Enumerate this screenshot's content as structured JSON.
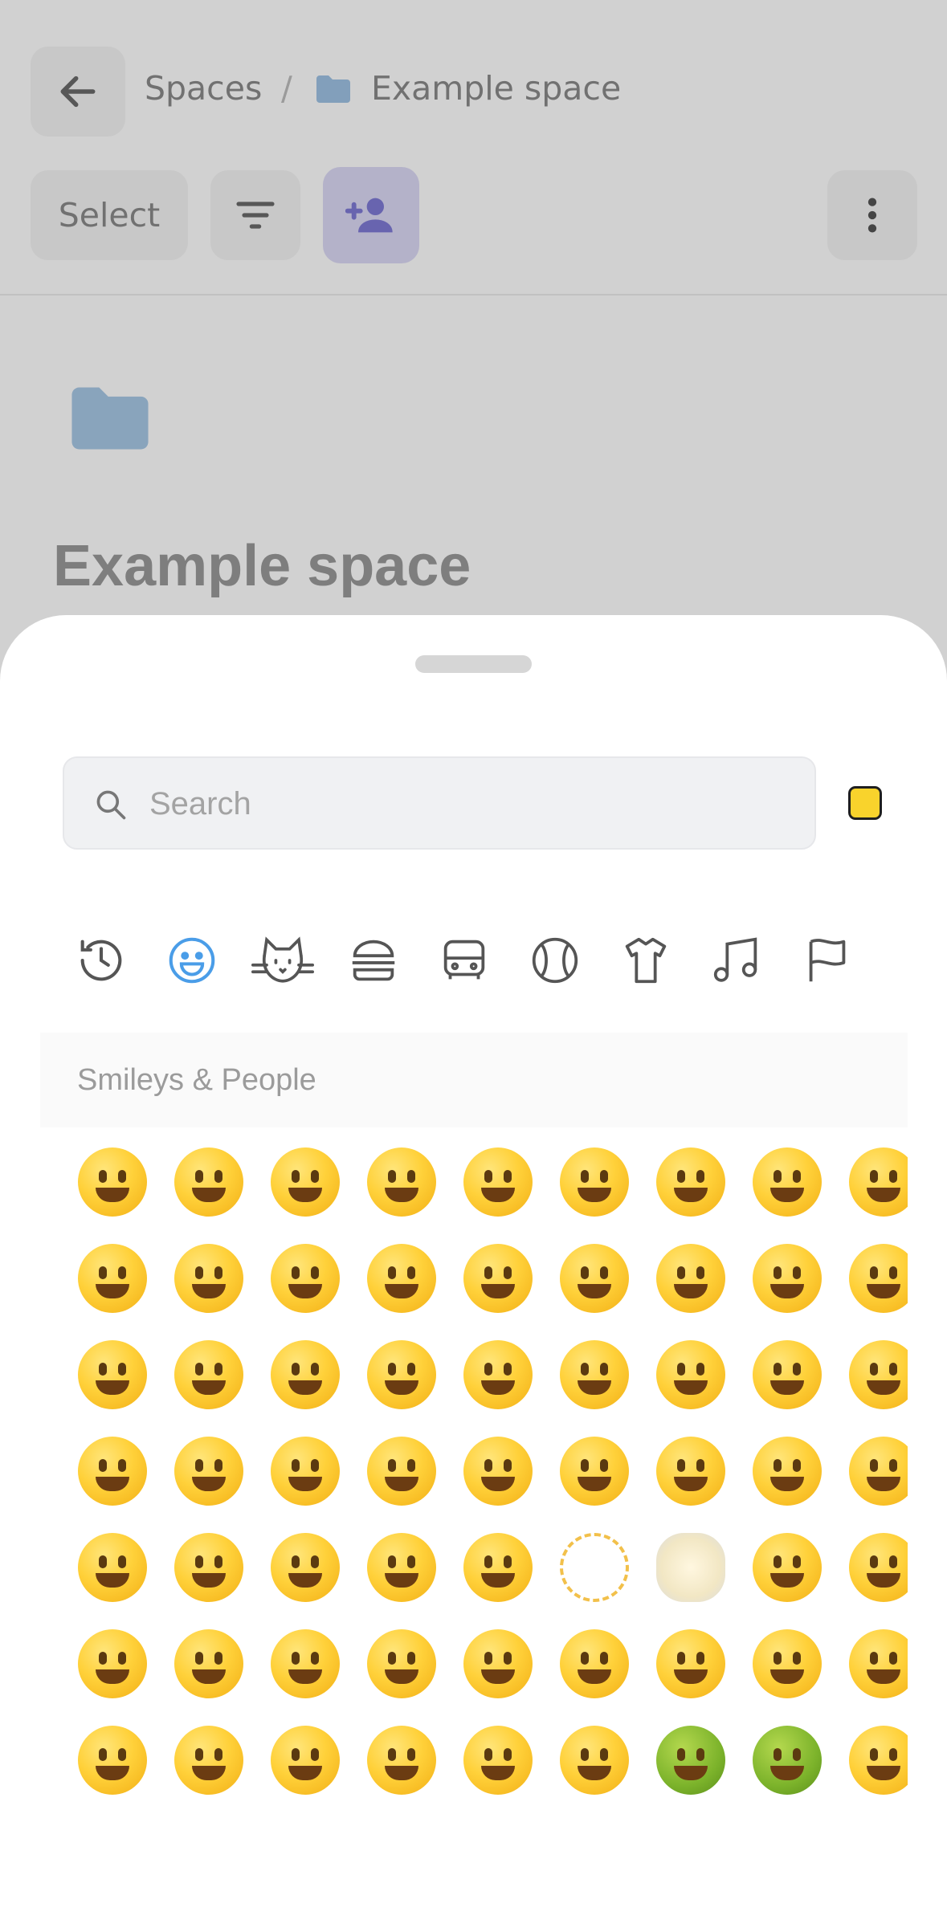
{
  "header": {
    "breadcrumb_root": "Spaces",
    "breadcrumb_sep": "/",
    "breadcrumb_current": "Example space"
  },
  "toolbar": {
    "select_label": "Select"
  },
  "space": {
    "title": "Example space"
  },
  "emoji_picker": {
    "search_placeholder": "Search",
    "skin_tone_color": "#f9d32c",
    "categories": [
      {
        "name": "recent-icon"
      },
      {
        "name": "smileys-icon",
        "active": true
      },
      {
        "name": "animals-icon"
      },
      {
        "name": "food-icon"
      },
      {
        "name": "travel-icon"
      },
      {
        "name": "activity-icon"
      },
      {
        "name": "objects-icon"
      },
      {
        "name": "symbols-icon"
      },
      {
        "name": "flags-icon"
      }
    ],
    "section_title": "Smileys & People",
    "rows": [
      [
        "😀",
        "😃",
        "😄",
        "😁",
        "😆",
        "😅",
        "🤣",
        "😂",
        "🙂"
      ],
      [
        "🙃",
        "🫠",
        "😉",
        "😊",
        "😇",
        "🥰",
        "😍",
        "🤩",
        "😘"
      ],
      [
        "😗",
        "☺️",
        "😚",
        "😙",
        "🥲",
        "😋",
        "😛",
        "😜",
        "🤪"
      ],
      [
        "😝",
        "🤑",
        "🤗",
        "🤭",
        "🫢",
        "🫣",
        "🤫",
        "🤔",
        "🫡"
      ],
      [
        "🤐",
        "🤨",
        "😐",
        "😑",
        "😶",
        "🫥",
        "😶‍🌫️",
        "😏",
        "😒"
      ],
      [
        "🙄",
        "😬",
        "😮‍💨",
        "🤥",
        "😵‍💫",
        "🫨",
        "🫤",
        "😌",
        "😔"
      ],
      [
        "😪",
        "🤤",
        "😴",
        "😷",
        "🤒",
        "🤕",
        "🤢",
        "🤮",
        "🤧"
      ]
    ]
  },
  "colors": {
    "accent": "#4a9de8",
    "add_button_bg": "#dcdaf6",
    "add_button_icon": "#7f7bd6"
  }
}
